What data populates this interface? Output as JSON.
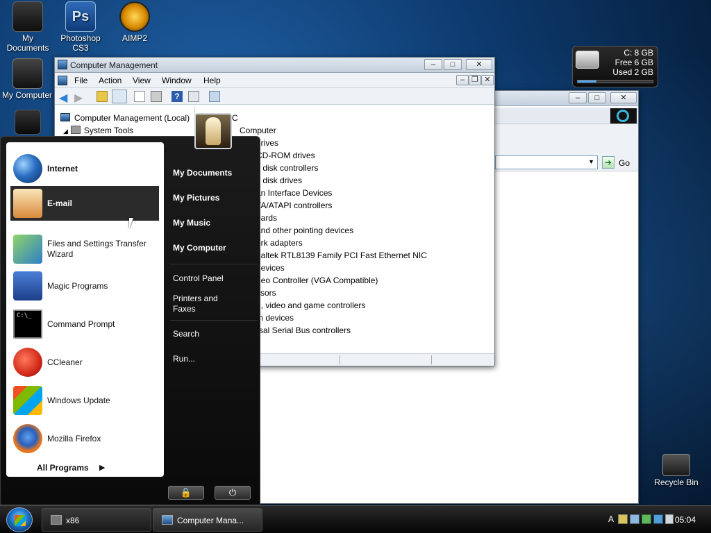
{
  "desktop": {
    "icons": [
      {
        "label": "My Documents",
        "icon": "folder-icon"
      },
      {
        "label": "Photoshop CS3",
        "icon": "photoshop-icon"
      },
      {
        "label": "AIMP2",
        "icon": "aimp-icon"
      },
      {
        "label": "My Computer",
        "icon": "computer-icon"
      },
      {
        "label": "Recycle Bin",
        "icon": "recycle-bin-icon"
      }
    ]
  },
  "drive_gadget": {
    "drive": "C:  8 GB",
    "free": "Free 6 GB",
    "used": "Used 2 GB",
    "used_fraction": 0.25
  },
  "computer_management": {
    "title": "Computer Management",
    "menu": [
      "File",
      "Action",
      "View",
      "Window",
      "Help"
    ],
    "tree_root": "Computer Management (Local)",
    "tree_system_tools": "System Tools",
    "device_header_suffix": "C",
    "devices": [
      "Computer",
      "drives",
      "CD-ROM drives",
      "y disk controllers",
      "y disk drives",
      "an Interface Devices",
      "TA/ATAPI controllers",
      "oards",
      "and other pointing devices",
      "ork adapters",
      "ealtek RTL8139 Family PCI Fast Ethernet NIC",
      "devices",
      "deo Controller (VGA Compatible)",
      "ssors",
      "d, video and game controllers",
      "m devices",
      "rsal Serial Bus controllers"
    ]
  },
  "back_window": {
    "go_label": "Go"
  },
  "start_menu": {
    "pinned": [
      {
        "label": "Internet",
        "icon": "globe-icon",
        "bold": true
      },
      {
        "label": "E-mail",
        "icon": "email-icon",
        "bold": true,
        "selected": true
      }
    ],
    "recent": [
      {
        "label": "Files and Settings Transfer Wizard",
        "icon": "transfer-wizard-icon"
      },
      {
        "label": "Magic Programs",
        "icon": "castle-icon"
      },
      {
        "label": "Command Prompt",
        "icon": "command-prompt-icon"
      },
      {
        "label": "CCleaner",
        "icon": "ccleaner-icon"
      },
      {
        "label": "Windows Update",
        "icon": "windows-update-icon"
      },
      {
        "label": "Mozilla Firefox",
        "icon": "firefox-icon"
      }
    ],
    "all_programs": "All Programs",
    "right": {
      "my_documents": "My Documents",
      "my_pictures": "My Pictures",
      "my_music": "My Music",
      "my_computer": "My Computer",
      "control_panel": "Control Panel",
      "printers_and_faxes": "Printers and Faxes",
      "search": "Search",
      "run": "Run..."
    }
  },
  "taskbar": {
    "items": [
      {
        "label": "x86"
      },
      {
        "label": "Computer Mana..."
      }
    ],
    "language": "A",
    "clock": "05:04",
    "clock_suffix": "‮"
  }
}
